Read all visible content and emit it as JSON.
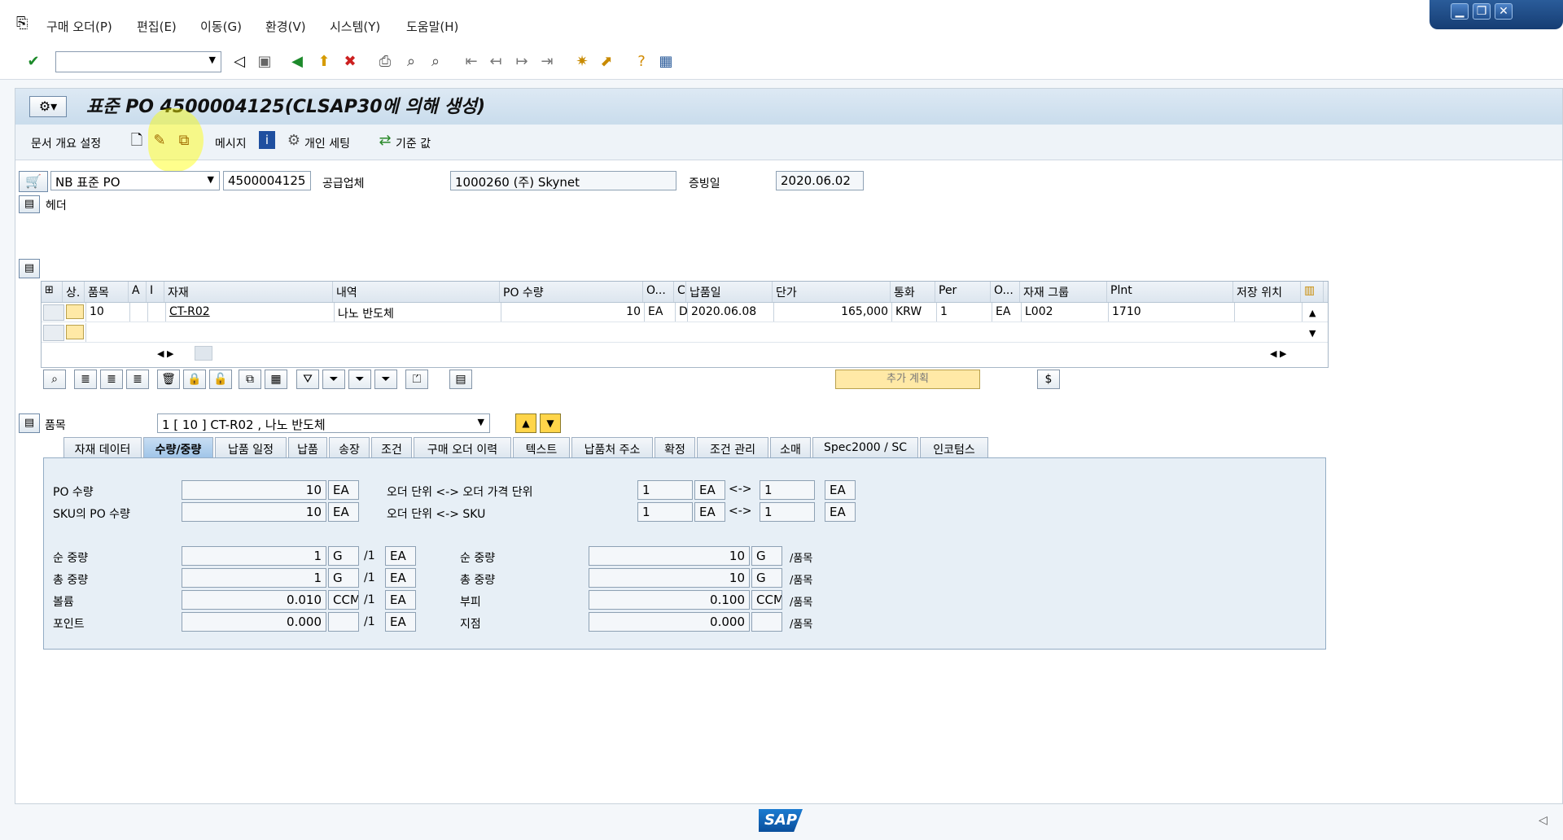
{
  "menu": {
    "items": [
      "구매 오더(P)",
      "편집(E)",
      "이동(G)",
      "환경(V)",
      "시스템(Y)",
      "도움말(H)"
    ]
  },
  "window_controls": {
    "minimize": "▁",
    "restore": "❐",
    "close": "✕"
  },
  "title": "표준 PO 4500004125(CLSAP30에 의해 생성)",
  "app_toolbar": {
    "doc_overview": "문서 개요 설정",
    "messages": "메시지",
    "personal_settings": "개인 세팅",
    "defaults": "기준 값"
  },
  "header": {
    "doc_type": "NB 표준 PO",
    "po_number": "4500004125",
    "vendor_label": "공급업체",
    "vendor": "1000260 (주) Skynet",
    "doc_date_label": "증빙일",
    "doc_date": "2020.06.02",
    "header_label": "헤더"
  },
  "items_table": {
    "columns": [
      "상.",
      "품목",
      "A",
      "I",
      "자재",
      "내역",
      "PO 수량",
      "O...",
      "C",
      "납품일",
      "단가",
      "통화",
      "Per",
      "O...",
      "자재 그룹",
      "Plnt",
      "저장 위치"
    ],
    "rows": [
      [
        "",
        "10",
        "",
        "",
        "CT-R02",
        "나노 반도체",
        "10",
        "EA",
        "D",
        "2020.06.08",
        "165,000",
        "KRW",
        "1",
        "EA",
        "L002",
        "1710",
        ""
      ]
    ],
    "additional_planning": "추가 계획"
  },
  "item_detail": {
    "label": "품목",
    "selector": "1 [ 10 ] CT-R02 , 나노 반도체",
    "tabs": [
      "자재 데이터",
      "수량/중량",
      "납품 일정",
      "납품",
      "송장",
      "조건",
      "구매 오더 이력",
      "텍스트",
      "납품처 주소",
      "확정",
      "조건 관리",
      "소매",
      "Spec2000 / SC",
      "인코텀스"
    ],
    "active_tab": "수량/중량"
  },
  "qty_weight": {
    "po_qty_label": "PO 수량",
    "po_qty": "10",
    "po_qty_unit": "EA",
    "sku_qty_label": "SKU의 PO 수량",
    "sku_qty": "10",
    "sku_qty_unit": "EA",
    "conv1_label": "오더 단위 <-> 오더 가격 단위",
    "conv1_a": "1",
    "conv1_a_unit": "EA",
    "conv1_b": "1",
    "conv1_b_unit": "EA",
    "conv2_label": "오더 단위 <-> SKU",
    "conv2_a": "1",
    "conv2_a_unit": "EA",
    "conv2_b": "1",
    "conv2_b_unit": "EA",
    "arrow": "<->",
    "left": [
      {
        "label": "순 중량",
        "value": "1",
        "unit": "G",
        "per": "/1",
        "per_unit": "EA"
      },
      {
        "label": "총 중량",
        "value": "1",
        "unit": "G",
        "per": "/1",
        "per_unit": "EA"
      },
      {
        "label": "볼륨",
        "value": "0.010",
        "unit": "CCM",
        "per": "/1",
        "per_unit": "EA"
      },
      {
        "label": "포인트",
        "value": "0.000",
        "unit": "",
        "per": "/1",
        "per_unit": "EA"
      }
    ],
    "right": [
      {
        "label": "순 중량",
        "value": "10",
        "unit": "G",
        "suffix": "/품목"
      },
      {
        "label": "총 중량",
        "value": "10",
        "unit": "G",
        "suffix": "/품목"
      },
      {
        "label": "부피",
        "value": "0.100",
        "unit": "CCM",
        "suffix": "/품목"
      },
      {
        "label": "지점",
        "value": "0.000",
        "unit": "",
        "suffix": "/품목"
      }
    ]
  },
  "footer": {
    "logo_text": "SAP"
  }
}
